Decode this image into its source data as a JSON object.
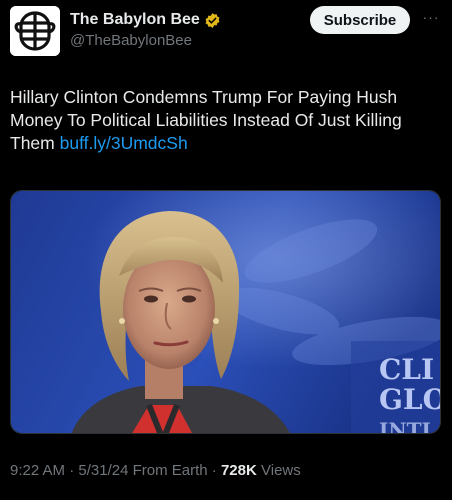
{
  "author": {
    "display_name": "The Babylon Bee",
    "handle": "@TheBabylonBee",
    "avatar_icon": "babylon-bee-logo-icon",
    "verified_icon": "verified-gold-badge-icon",
    "verified_color": "#e2b719"
  },
  "actions": {
    "subscribe_label": "Subscribe",
    "more_label": "···"
  },
  "tweet": {
    "text": "Hillary Clinton Condemns Trump For Paying Hush Money To Political Liabilities Instead Of Just Killing Them ",
    "link": "buff.ly/3UmdcSh"
  },
  "media": {
    "backdrop_text_line1": "CLI",
    "backdrop_text_line2": "GLO",
    "backdrop_text_line3": "INTI"
  },
  "meta": {
    "time": "9:22 AM",
    "separator": " · ",
    "date": "5/31/24",
    "source": "From Earth",
    "views_count": "728K",
    "views_label": "Views"
  },
  "colors": {
    "background": "#000000",
    "text": "#e7e9ea",
    "muted": "#71767b",
    "link": "#1d9bf0",
    "button_bg": "#eff3f4"
  }
}
